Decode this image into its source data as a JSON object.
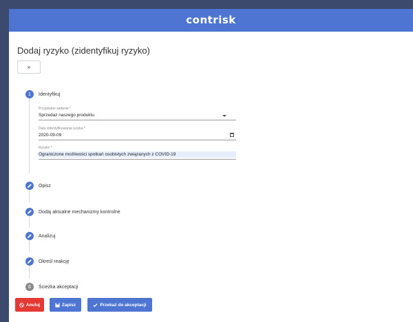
{
  "header": {
    "logo": "contrisk"
  },
  "page": {
    "title": "Dodaj ryzyko (zidentyfikuj ryzyko)",
    "collapse_icon": "double-chevron-down-icon"
  },
  "steps": [
    {
      "number": "1",
      "label": "Identyfikuj",
      "state": "active"
    },
    {
      "icon": "pencil-icon",
      "label": "Opisz"
    },
    {
      "icon": "pencil-icon",
      "label": "Dodaj aktualne mechanizmy kontrolne"
    },
    {
      "icon": "pencil-icon",
      "label": "Analizuj"
    },
    {
      "icon": "pencil-icon",
      "label": "Określ reakcję"
    },
    {
      "number": "6",
      "label": "Ścieżka akceptacji",
      "state": "disabled"
    }
  ],
  "form": {
    "task": {
      "label": "Przypisane zadanie *",
      "value": "Sprzedaż naszego produktu"
    },
    "date": {
      "label": "Data zidentyfikowania ryzyka *",
      "value": "2020-09-09"
    },
    "risk": {
      "label": "Ryzyko *",
      "value": "Ograniczone możliwości spotkań osobistych związanych z COVID-19"
    }
  },
  "buttons": {
    "cancel": "Anuluj",
    "save": "Zapisz",
    "submit": "Przekaż do akceptacji"
  },
  "colors": {
    "primary": "#4f75d3",
    "danger": "#e53935",
    "disabled": "#8a8a8a"
  }
}
